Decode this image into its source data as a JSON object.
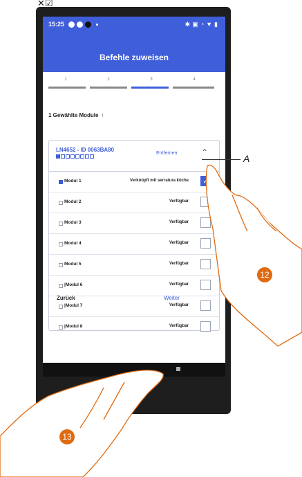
{
  "status": {
    "time": "15:25"
  },
  "header": {
    "title": "Befehle zuweisen"
  },
  "steps": [
    "1",
    "2",
    "3",
    "4"
  ],
  "active_step": 3,
  "selection": {
    "count_label": "1 Gewählte Module",
    "info_icon": "i"
  },
  "device": {
    "name": "LN4652 - ID 0063BA80",
    "remove_label": "Entfernen",
    "pager_total": 8,
    "pager_active": 1
  },
  "modules": [
    {
      "name": "Modul 1",
      "state": "Verknüpft mit serratura küche",
      "checked": true
    },
    {
      "name": "Modul 2",
      "state": "Verfügbar",
      "checked": false
    },
    {
      "name": "Modul 3",
      "state": "Verfügbar",
      "checked": false
    },
    {
      "name": "Modul 4",
      "state": "Verfügbar",
      "checked": false
    },
    {
      "name": "Modul 5",
      "state": "Verfügbar",
      "checked": false
    },
    {
      "name": "|Modul 6",
      "state": "Verfügbar",
      "checked": false
    },
    {
      "name": "|Modul 7",
      "state": "Verfügbar",
      "checked": false
    },
    {
      "name": "|Modul 8",
      "state": "Verfügbar",
      "checked": false
    }
  ],
  "footer": {
    "back_label": "Zurück",
    "next_label": "Weiter"
  },
  "annotations": {
    "label": "A",
    "badge_hand_right": "12",
    "badge_hand_bottom": "13"
  },
  "colors": {
    "brand_blue": "#3f5ed9",
    "badge_orange": "#e06a10"
  }
}
